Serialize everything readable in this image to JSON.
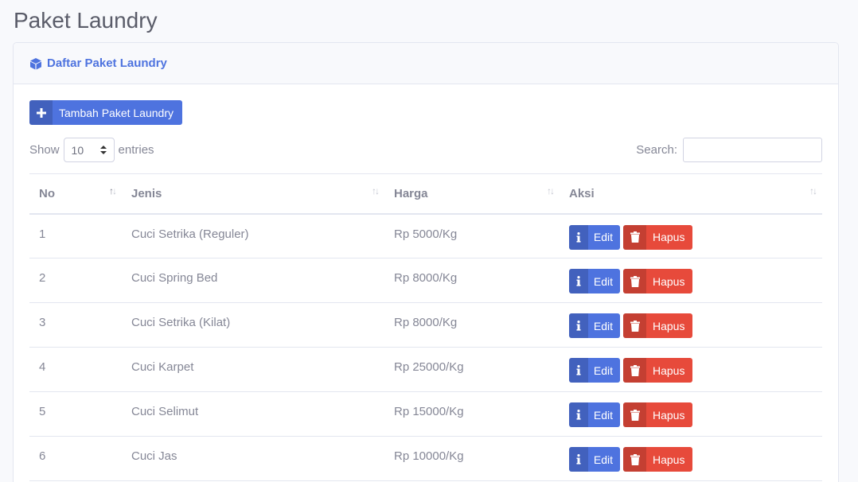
{
  "page": {
    "title": "Paket Laundry"
  },
  "card": {
    "header": "Daftar Paket Laundry"
  },
  "toolbar": {
    "add_label": "Tambah Paket Laundry"
  },
  "length": {
    "show": "Show",
    "value": "10",
    "entries": "entries"
  },
  "search": {
    "label": "Search:",
    "value": ""
  },
  "table": {
    "columns": [
      "No",
      "Jenis",
      "Harga",
      "Aksi"
    ],
    "rows": [
      {
        "no": "1",
        "jenis": "Cuci Setrika (Reguler)",
        "harga": "Rp 5000/Kg"
      },
      {
        "no": "2",
        "jenis": "Cuci Spring Bed",
        "harga": "Rp 8000/Kg"
      },
      {
        "no": "3",
        "jenis": "Cuci Setrika (Kilat)",
        "harga": "Rp 8000/Kg"
      },
      {
        "no": "4",
        "jenis": "Cuci Karpet",
        "harga": "Rp 25000/Kg"
      },
      {
        "no": "5",
        "jenis": "Cuci Selimut",
        "harga": "Rp 15000/Kg"
      },
      {
        "no": "6",
        "jenis": "Cuci Jas",
        "harga": "Rp 10000/Kg"
      }
    ],
    "edit_label": "Edit",
    "delete_label": "Hapus"
  },
  "colors": {
    "primary": "#4e73df",
    "danger": "#e74a3b",
    "text": "#858796"
  }
}
